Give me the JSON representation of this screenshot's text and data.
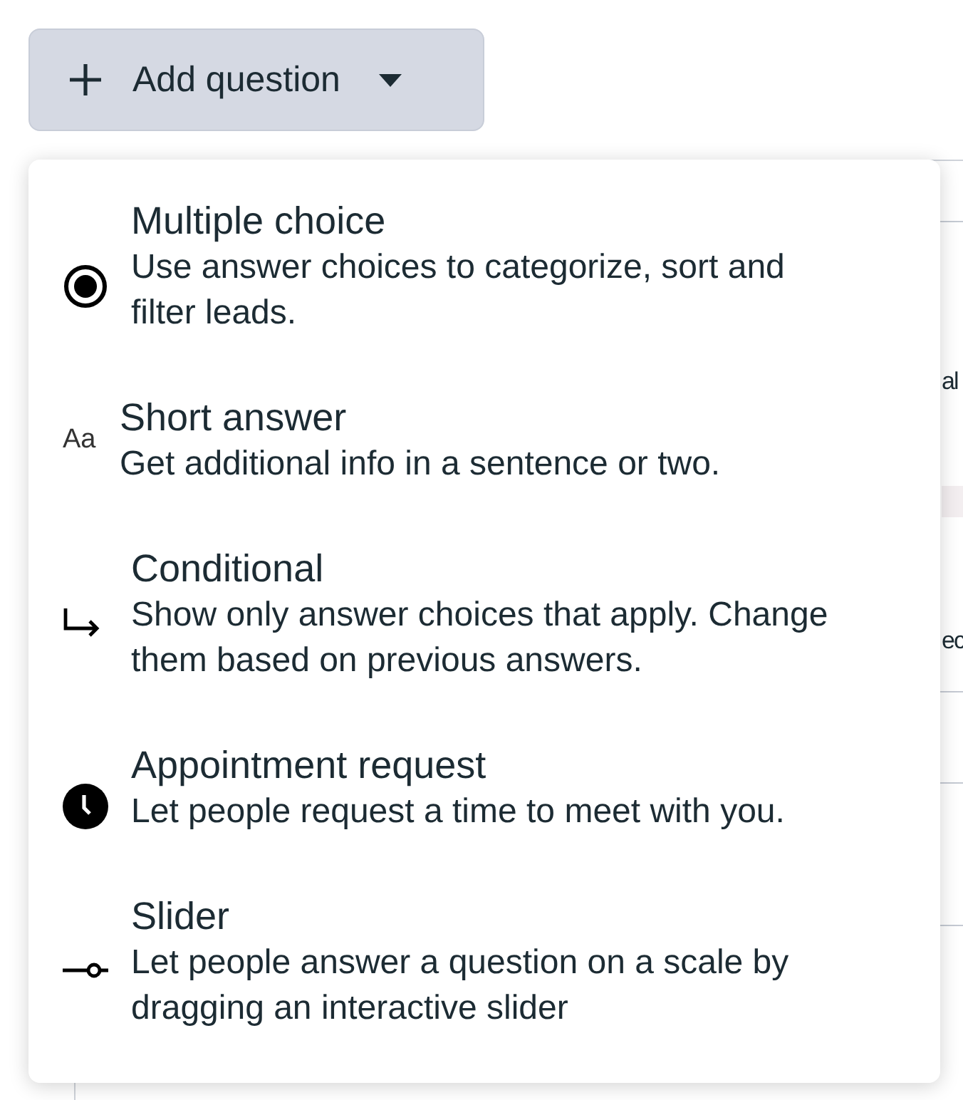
{
  "add_button": {
    "label": "Add question"
  },
  "background_card": {
    "fragments": [
      "al",
      "ec"
    ]
  },
  "menu": {
    "items": [
      {
        "kind": "radio",
        "title": "Multiple choice",
        "description": "Use answer choices to categorize, sort and filter leads."
      },
      {
        "kind": "text",
        "icon_text": "Aa",
        "title": "Short answer",
        "description": "Get additional info in a sentence or two."
      },
      {
        "kind": "branch",
        "title": "Conditional",
        "description": "Show only answer choices that apply. Change them based on previous answers."
      },
      {
        "kind": "clock",
        "title": "Appointment request",
        "description": "Let people request a time to meet with you."
      },
      {
        "kind": "slider",
        "title": "Slider",
        "description": "Let people answer a question on a scale by dragging an interactive slider"
      }
    ]
  }
}
